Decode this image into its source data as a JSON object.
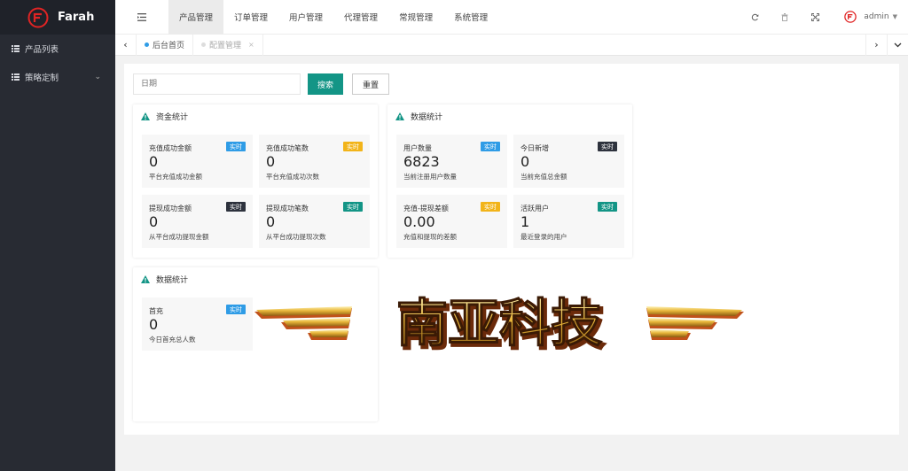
{
  "brand": {
    "name": "Farah"
  },
  "sidebar": {
    "items": [
      {
        "label": "产品列表",
        "icon": "list-icon",
        "has_chevron": false
      },
      {
        "label": "策略定制",
        "icon": "list-icon",
        "has_chevron": true
      }
    ]
  },
  "header": {
    "nav": [
      "产品管理",
      "订单管理",
      "用户管理",
      "代理管理",
      "常规管理",
      "系统管理"
    ],
    "active_nav": 0,
    "user": "admin",
    "icons": [
      "refresh-icon",
      "trash-icon",
      "fullscreen-icon"
    ]
  },
  "tabs": [
    {
      "label": "后台首页",
      "active": true
    },
    {
      "label": "配置管理",
      "active": false
    }
  ],
  "search": {
    "placeholder": "日期",
    "search_label": "搜索",
    "reset_label": "重置"
  },
  "panels": [
    {
      "title": "资金统计",
      "cards": [
        {
          "label": "充值成功金额",
          "value": "0",
          "desc": "平台充值成功金额",
          "badge": "实时",
          "badge_color": "#2f9ce6"
        },
        {
          "label": "充值成功笔数",
          "value": "0",
          "desc": "平台充值成功次数",
          "badge": "实时",
          "badge_color": "#f2b41a"
        },
        {
          "label": "提现成功金额",
          "value": "0",
          "desc": "从平台成功提现金额",
          "badge": "实时",
          "badge_color": "#2d323d"
        },
        {
          "label": "提现成功笔数",
          "value": "0",
          "desc": "从平台成功提现次数",
          "badge": "实时",
          "badge_color": "#139586"
        }
      ]
    },
    {
      "title": "数据统计",
      "cards": [
        {
          "label": "用户数量",
          "value": "6823",
          "desc": "当前注册用户数量",
          "badge": "实时",
          "badge_color": "#2f9ce6"
        },
        {
          "label": "今日新增",
          "value": "0",
          "desc": "当前充值总金额",
          "badge": "实时",
          "badge_color": "#2d323d"
        },
        {
          "label": "充值-提现差额",
          "value": "0.00",
          "desc": "充值和提现的差额",
          "badge": "实时",
          "badge_color": "#f2b41a"
        },
        {
          "label": "活跃用户",
          "value": "1",
          "desc": "最近登录的用户",
          "badge": "实时",
          "badge_color": "#139586"
        }
      ]
    },
    {
      "title": "数据统计",
      "cards": [
        {
          "label": "首充",
          "value": "0",
          "desc": "今日首充总人数",
          "badge": "实时",
          "badge_color": "#2f9ce6"
        }
      ]
    }
  ],
  "watermark": {
    "text": "南亚科技"
  },
  "colors": {
    "sidebar": "#282b33",
    "primary": "#139586",
    "warn": "#139586"
  }
}
